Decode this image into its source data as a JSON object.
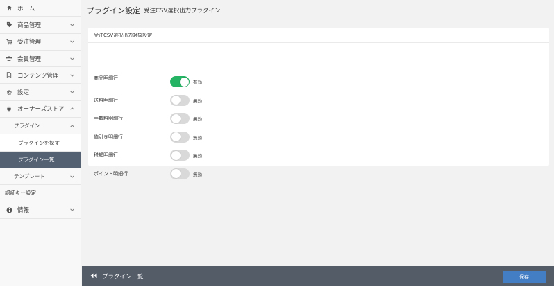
{
  "sidebar": {
    "items": [
      {
        "label": "ホーム"
      },
      {
        "label": "商品管理"
      },
      {
        "label": "受注管理"
      },
      {
        "label": "会員管理"
      },
      {
        "label": "コンテンツ管理"
      },
      {
        "label": "設定"
      },
      {
        "label": "オーナーズストア"
      },
      {
        "label": "プラグイン"
      },
      {
        "label": "プラグインを探す"
      },
      {
        "label": "プラグイン一覧"
      },
      {
        "label": "テンプレート"
      },
      {
        "label": "認証キー設定"
      },
      {
        "label": "情報"
      }
    ]
  },
  "header": {
    "title": "プラグイン設定",
    "subtitle": "受注CSV選択出力プラグイン"
  },
  "card": {
    "title": "受注CSV選択出力対象設定",
    "rows": [
      {
        "label": "商品明細行",
        "state": "有効",
        "enabled": true
      },
      {
        "label": "送料明細行",
        "state": "無効",
        "enabled": false
      },
      {
        "label": "手数料明細行",
        "state": "無効",
        "enabled": false
      },
      {
        "label": "値引き明細行",
        "state": "無効",
        "enabled": false
      },
      {
        "label": "税額明細行",
        "state": "無効",
        "enabled": false
      },
      {
        "label": "ポイント明細行",
        "state": "無効",
        "enabled": false
      }
    ]
  },
  "footer": {
    "back_label": "プラグイン一覧",
    "save_label": "保存"
  },
  "colors": {
    "toggle_on": "#25b364",
    "toggle_off": "#d9d9d9",
    "footer_bg": "#545c68",
    "active_nav": "#546173",
    "save_button": "#437ec4"
  }
}
